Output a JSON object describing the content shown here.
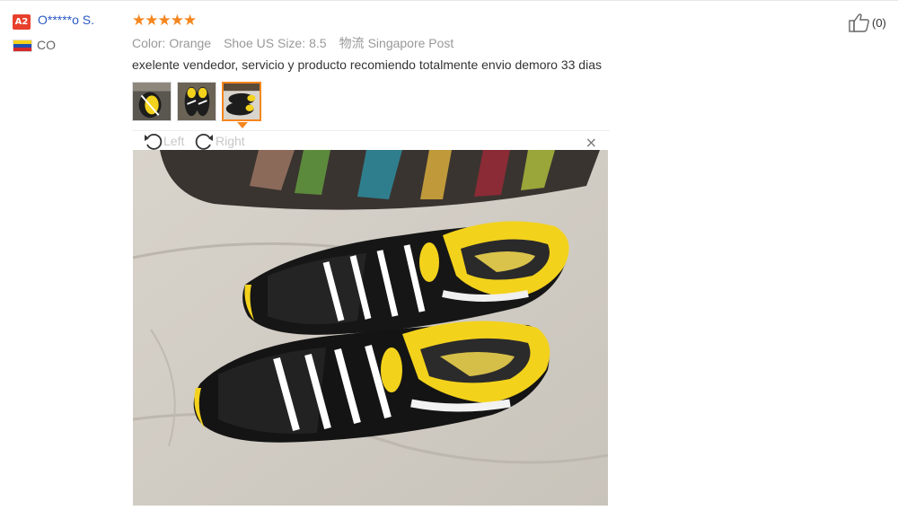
{
  "user": {
    "level": "A2",
    "name": "O*****o S.",
    "country": "CO",
    "flag_colors": [
      "#f6d41a",
      "#1f4fb3",
      "#d32a2a"
    ]
  },
  "review": {
    "rating": 5,
    "stars": "★★★★★",
    "attributes": [
      {
        "label": "Color:",
        "value": "Orange"
      },
      {
        "label": "Shoe US Size:",
        "value": "8.5"
      },
      {
        "label": "物流",
        "value": "Singapore Post"
      }
    ],
    "text": "exelente vendedor, servicio y producto recomiendo totalmente envio demoro 33 dias",
    "selected_photo": 3
  },
  "viewer": {
    "rotate_left_label": "Left",
    "rotate_right_label": "Right",
    "close_glyph": "×"
  },
  "like": {
    "count": "(0)"
  },
  "colors": {
    "accent": "#f5861f",
    "username": "#2a59c2",
    "badge": "#e8402c",
    "shoe_yellow": "#f3d21c"
  }
}
